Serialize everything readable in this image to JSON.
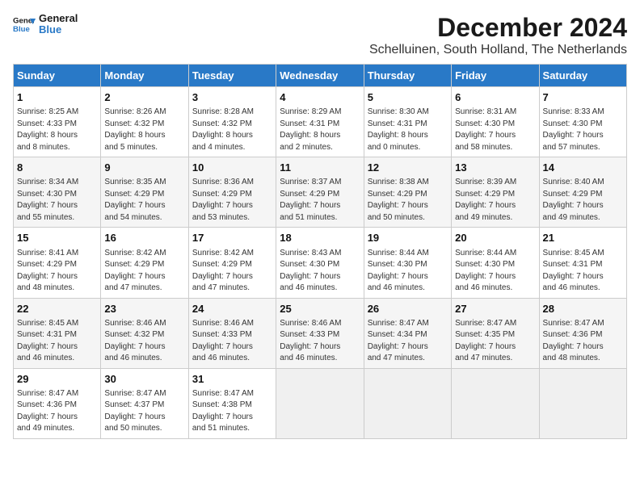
{
  "logo": {
    "line1": "General",
    "line2": "Blue"
  },
  "title": "December 2024",
  "subtitle": "Schelluinen, South Holland, The Netherlands",
  "days_of_week": [
    "Sunday",
    "Monday",
    "Tuesday",
    "Wednesday",
    "Thursday",
    "Friday",
    "Saturday"
  ],
  "weeks": [
    [
      {
        "day": "1",
        "info": "Sunrise: 8:25 AM\nSunset: 4:33 PM\nDaylight: 8 hours\nand 8 minutes."
      },
      {
        "day": "2",
        "info": "Sunrise: 8:26 AM\nSunset: 4:32 PM\nDaylight: 8 hours\nand 5 minutes."
      },
      {
        "day": "3",
        "info": "Sunrise: 8:28 AM\nSunset: 4:32 PM\nDaylight: 8 hours\nand 4 minutes."
      },
      {
        "day": "4",
        "info": "Sunrise: 8:29 AM\nSunset: 4:31 PM\nDaylight: 8 hours\nand 2 minutes."
      },
      {
        "day": "5",
        "info": "Sunrise: 8:30 AM\nSunset: 4:31 PM\nDaylight: 8 hours\nand 0 minutes."
      },
      {
        "day": "6",
        "info": "Sunrise: 8:31 AM\nSunset: 4:30 PM\nDaylight: 7 hours\nand 58 minutes."
      },
      {
        "day": "7",
        "info": "Sunrise: 8:33 AM\nSunset: 4:30 PM\nDaylight: 7 hours\nand 57 minutes."
      }
    ],
    [
      {
        "day": "8",
        "info": "Sunrise: 8:34 AM\nSunset: 4:30 PM\nDaylight: 7 hours\nand 55 minutes."
      },
      {
        "day": "9",
        "info": "Sunrise: 8:35 AM\nSunset: 4:29 PM\nDaylight: 7 hours\nand 54 minutes."
      },
      {
        "day": "10",
        "info": "Sunrise: 8:36 AM\nSunset: 4:29 PM\nDaylight: 7 hours\nand 53 minutes."
      },
      {
        "day": "11",
        "info": "Sunrise: 8:37 AM\nSunset: 4:29 PM\nDaylight: 7 hours\nand 51 minutes."
      },
      {
        "day": "12",
        "info": "Sunrise: 8:38 AM\nSunset: 4:29 PM\nDaylight: 7 hours\nand 50 minutes."
      },
      {
        "day": "13",
        "info": "Sunrise: 8:39 AM\nSunset: 4:29 PM\nDaylight: 7 hours\nand 49 minutes."
      },
      {
        "day": "14",
        "info": "Sunrise: 8:40 AM\nSunset: 4:29 PM\nDaylight: 7 hours\nand 49 minutes."
      }
    ],
    [
      {
        "day": "15",
        "info": "Sunrise: 8:41 AM\nSunset: 4:29 PM\nDaylight: 7 hours\nand 48 minutes."
      },
      {
        "day": "16",
        "info": "Sunrise: 8:42 AM\nSunset: 4:29 PM\nDaylight: 7 hours\nand 47 minutes."
      },
      {
        "day": "17",
        "info": "Sunrise: 8:42 AM\nSunset: 4:29 PM\nDaylight: 7 hours\nand 47 minutes."
      },
      {
        "day": "18",
        "info": "Sunrise: 8:43 AM\nSunset: 4:30 PM\nDaylight: 7 hours\nand 46 minutes."
      },
      {
        "day": "19",
        "info": "Sunrise: 8:44 AM\nSunset: 4:30 PM\nDaylight: 7 hours\nand 46 minutes."
      },
      {
        "day": "20",
        "info": "Sunrise: 8:44 AM\nSunset: 4:30 PM\nDaylight: 7 hours\nand 46 minutes."
      },
      {
        "day": "21",
        "info": "Sunrise: 8:45 AM\nSunset: 4:31 PM\nDaylight: 7 hours\nand 46 minutes."
      }
    ],
    [
      {
        "day": "22",
        "info": "Sunrise: 8:45 AM\nSunset: 4:31 PM\nDaylight: 7 hours\nand 46 minutes."
      },
      {
        "day": "23",
        "info": "Sunrise: 8:46 AM\nSunset: 4:32 PM\nDaylight: 7 hours\nand 46 minutes."
      },
      {
        "day": "24",
        "info": "Sunrise: 8:46 AM\nSunset: 4:33 PM\nDaylight: 7 hours\nand 46 minutes."
      },
      {
        "day": "25",
        "info": "Sunrise: 8:46 AM\nSunset: 4:33 PM\nDaylight: 7 hours\nand 46 minutes."
      },
      {
        "day": "26",
        "info": "Sunrise: 8:47 AM\nSunset: 4:34 PM\nDaylight: 7 hours\nand 47 minutes."
      },
      {
        "day": "27",
        "info": "Sunrise: 8:47 AM\nSunset: 4:35 PM\nDaylight: 7 hours\nand 47 minutes."
      },
      {
        "day": "28",
        "info": "Sunrise: 8:47 AM\nSunset: 4:36 PM\nDaylight: 7 hours\nand 48 minutes."
      }
    ],
    [
      {
        "day": "29",
        "info": "Sunrise: 8:47 AM\nSunset: 4:36 PM\nDaylight: 7 hours\nand 49 minutes."
      },
      {
        "day": "30",
        "info": "Sunrise: 8:47 AM\nSunset: 4:37 PM\nDaylight: 7 hours\nand 50 minutes."
      },
      {
        "day": "31",
        "info": "Sunrise: 8:47 AM\nSunset: 4:38 PM\nDaylight: 7 hours\nand 51 minutes."
      },
      {
        "day": "",
        "info": ""
      },
      {
        "day": "",
        "info": ""
      },
      {
        "day": "",
        "info": ""
      },
      {
        "day": "",
        "info": ""
      }
    ]
  ]
}
